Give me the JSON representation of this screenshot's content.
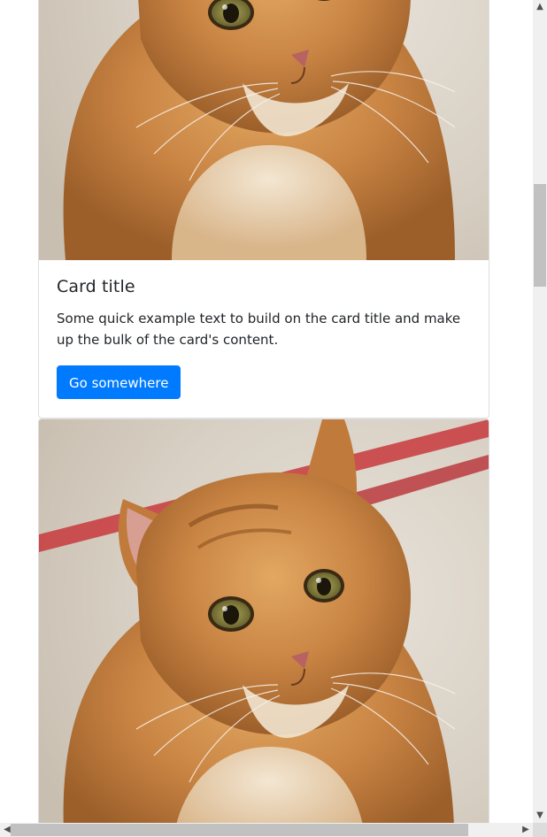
{
  "cards": [
    {
      "image_alt": "Orange tabby cat",
      "title": "Card title",
      "text": "Some quick example text to build on the card title and make up the bulk of the card's content.",
      "button_label": "Go somewhere"
    },
    {
      "image_alt": "Orange tabby cat"
    }
  ],
  "scrollbar": {
    "up_icon": "chevron-up-icon",
    "down_icon": "chevron-down-icon",
    "left_icon": "chevron-left-icon",
    "right_icon": "chevron-right-icon"
  },
  "colors": {
    "primary": "#007bff",
    "card_border": "rgba(0,0,0,0.125)",
    "scrollbar_track": "#f0f0f0",
    "scrollbar_thumb": "#c1c1c1"
  }
}
